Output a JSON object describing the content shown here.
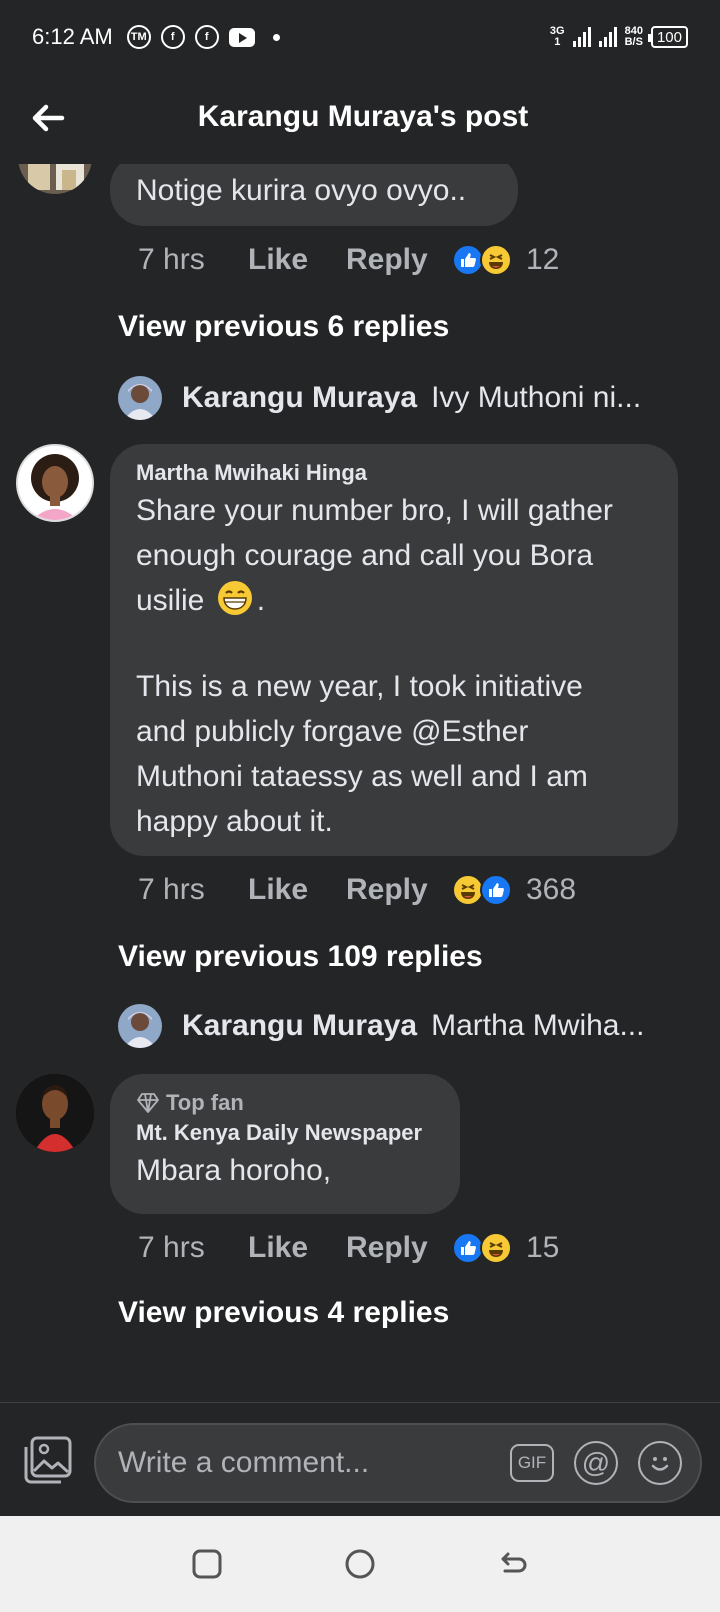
{
  "status_bar": {
    "time": "6:12 AM",
    "network": "3G",
    "network_sub": "1",
    "speed": "840",
    "speed_unit": "B/S",
    "battery": "100"
  },
  "header": {
    "title": "Karangu Muraya's post"
  },
  "comments": [
    {
      "text": "Notige kurira ovyo ovyo..",
      "time": "7 hrs",
      "like": "Like",
      "reply": "Reply",
      "reaction_count": "12",
      "view_previous": "View previous 6 replies",
      "latest_reply": {
        "name": "Karangu Muraya",
        "text": "Ivy Muthoni ni..."
      }
    },
    {
      "author": "Martha Mwihaki Hinga",
      "text_p1_a": "Share your number bro, I will gather",
      "text_p1_b": "enough courage and call you Bora",
      "text_p1_c": "usilie",
      "text_p1_end": ".",
      "text_p2_a": "This is a new year, I took initiative",
      "text_p2_b": "and publicly forgave @Esther",
      "text_p2_c": "Muthoni tataessy as well and I am",
      "text_p2_d": "happy about it.",
      "time": "7 hrs",
      "like": "Like",
      "reply": "Reply",
      "reaction_count": "368",
      "view_previous": "View previous 109 replies",
      "latest_reply": {
        "name": "Karangu Muraya",
        "text": "Martha Mwiha..."
      }
    },
    {
      "badge": "Top fan",
      "author": "Mt. Kenya Daily Newspaper",
      "text": "Mbara horoho,",
      "time": "7 hrs",
      "like": "Like",
      "reply": "Reply",
      "reaction_count": "15",
      "view_previous": "View previous 4 replies"
    }
  ],
  "composer": {
    "placeholder": "Write a comment...",
    "gif_label": "GIF",
    "mention_symbol": "@"
  },
  "colors": {
    "background": "#242526",
    "bubble": "#3a3b3c",
    "secondary_text": "#b0b3b8",
    "like_blue": "#1877f2",
    "haha_yellow": "#f7c935"
  }
}
